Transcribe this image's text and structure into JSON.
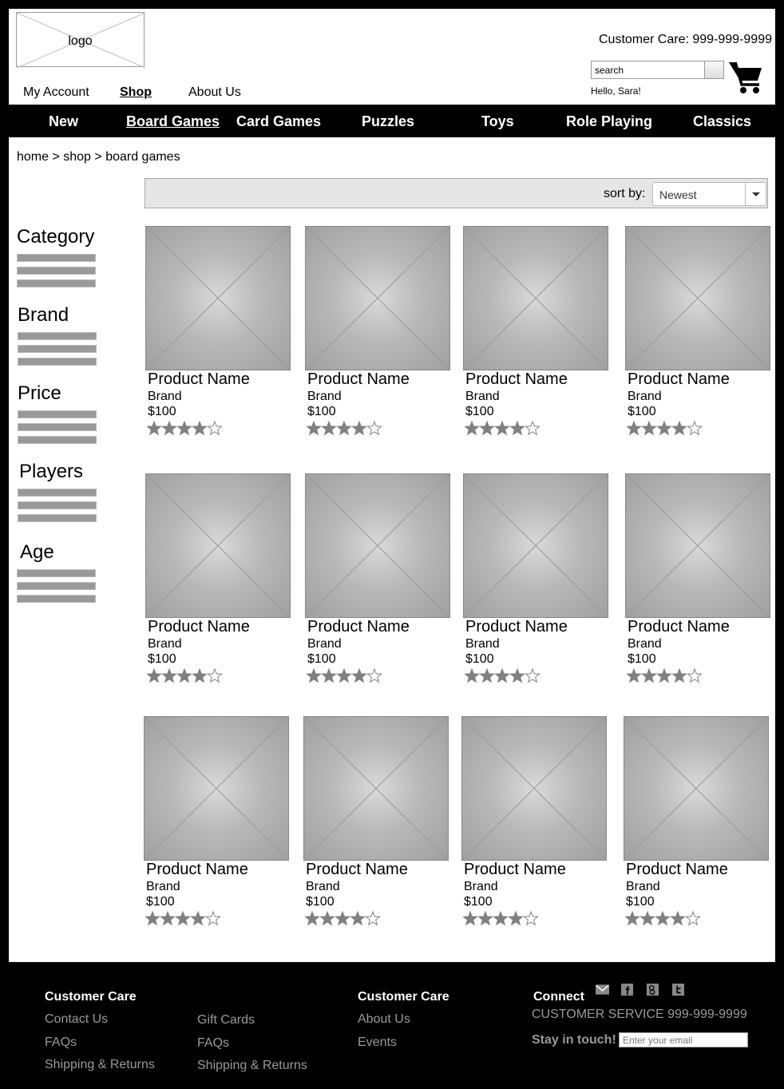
{
  "header": {
    "logo_label": "logo",
    "top_nav": [
      {
        "label": "My Account"
      },
      {
        "label": "Shop"
      },
      {
        "label": "About Us"
      }
    ],
    "customer_care": "Customer Care: 999-999-9999",
    "search": {
      "value": "search"
    },
    "greeting": "Hello, Sara!"
  },
  "main_nav": {
    "items": [
      {
        "label": "New"
      },
      {
        "label": "Board Games"
      },
      {
        "label": "Card Games"
      },
      {
        "label": "Puzzles"
      },
      {
        "label": "Toys"
      },
      {
        "label": "Role Playing"
      },
      {
        "label": "Classics"
      }
    ],
    "active": "Board Games"
  },
  "breadcrumb": "home > shop > board games",
  "sort": {
    "label": "sort by:",
    "selected": "Newest"
  },
  "filters": [
    {
      "title": "Category"
    },
    {
      "title": "Brand"
    },
    {
      "title": "Price"
    },
    {
      "title": "Players"
    },
    {
      "title": "Age"
    }
  ],
  "products": [
    {
      "name": "Product Name",
      "brand": "Brand",
      "price": "$100",
      "rating": 4,
      "rating_max": 5
    },
    {
      "name": "Product Name",
      "brand": "Brand",
      "price": "$100",
      "rating": 4,
      "rating_max": 5
    },
    {
      "name": "Product Name",
      "brand": "Brand",
      "price": "$100",
      "rating": 4,
      "rating_max": 5
    },
    {
      "name": "Product Name",
      "brand": "Brand",
      "price": "$100",
      "rating": 4,
      "rating_max": 5
    },
    {
      "name": "Product Name",
      "brand": "Brand",
      "price": "$100",
      "rating": 4,
      "rating_max": 5
    },
    {
      "name": "Product Name",
      "brand": "Brand",
      "price": "$100",
      "rating": 4,
      "rating_max": 5
    },
    {
      "name": "Product Name",
      "brand": "Brand",
      "price": "$100",
      "rating": 4,
      "rating_max": 5
    },
    {
      "name": "Product Name",
      "brand": "Brand",
      "price": "$100",
      "rating": 4,
      "rating_max": 5
    },
    {
      "name": "Product Name",
      "brand": "Brand",
      "price": "$100",
      "rating": 4,
      "rating_max": 5
    },
    {
      "name": "Product Name",
      "brand": "Brand",
      "price": "$100",
      "rating": 4,
      "rating_max": 5
    },
    {
      "name": "Product Name",
      "brand": "Brand",
      "price": "$100",
      "rating": 4,
      "rating_max": 5
    },
    {
      "name": "Product Name",
      "brand": "Brand",
      "price": "$100",
      "rating": 4,
      "rating_max": 5
    }
  ],
  "footer": {
    "col1": {
      "title": "Customer Care",
      "links": [
        "Contact Us",
        "FAQs",
        "Shipping & Returns"
      ]
    },
    "col2": {
      "links": [
        "Gift Cards",
        "FAQs",
        "Shipping & Returns"
      ]
    },
    "col3": {
      "title": "Customer Care",
      "links": [
        "About Us",
        "Events"
      ]
    },
    "connect": {
      "title": "Connect",
      "icons": [
        "email-icon",
        "facebook-icon",
        "google-plus-icon",
        "twitter-icon"
      ],
      "customer_service": "CUSTOMER SERVICE 999-999-9999",
      "stay_label": "Stay in touch!",
      "email_placeholder": "Enter your email"
    }
  }
}
